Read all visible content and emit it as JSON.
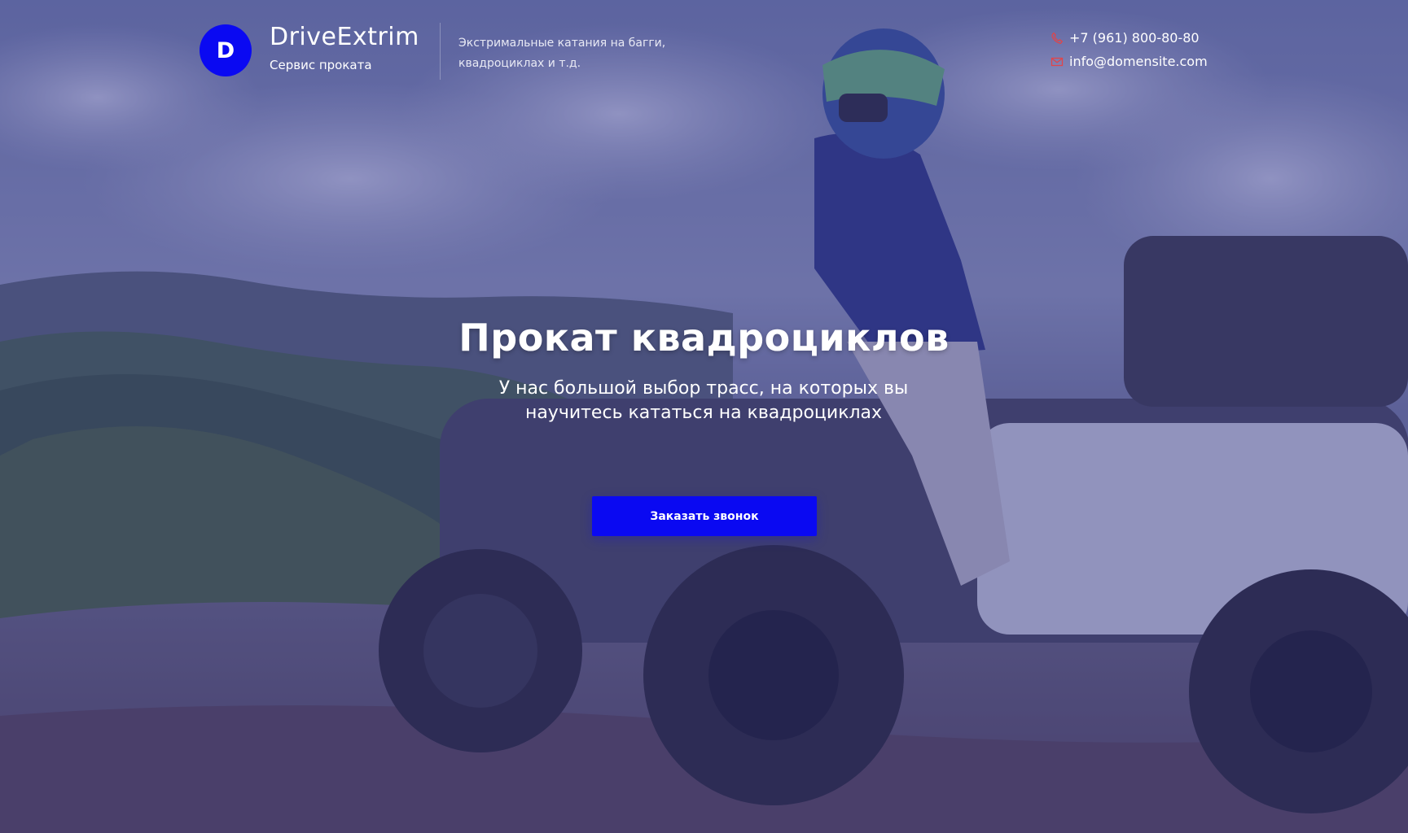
{
  "brand": {
    "logo_letter": "D",
    "name": "DriveExtrim",
    "subtitle": "Сервис проката",
    "tagline": "Экстримальные катания на багги, квадроциклах и т.д."
  },
  "contacts": {
    "phone": "+7 (961) 800-80-80",
    "email": "info@domensite.com",
    "phone_icon": "phone-icon",
    "email_icon": "envelope-icon",
    "icon_color": "#e0454a"
  },
  "hero": {
    "title": "Прокат квадроциклов",
    "subtitle": "У нас большой выбор трасс, на которых вы научитесь кататься на квадроциклах",
    "cta_label": "Заказать звонок",
    "background_image": "Rider on an ATV with mountains and cloudy sky, blue overlay"
  },
  "colors": {
    "accent": "#0a09f2",
    "overlay": "#3a3c8c",
    "text": "#ffffff"
  }
}
